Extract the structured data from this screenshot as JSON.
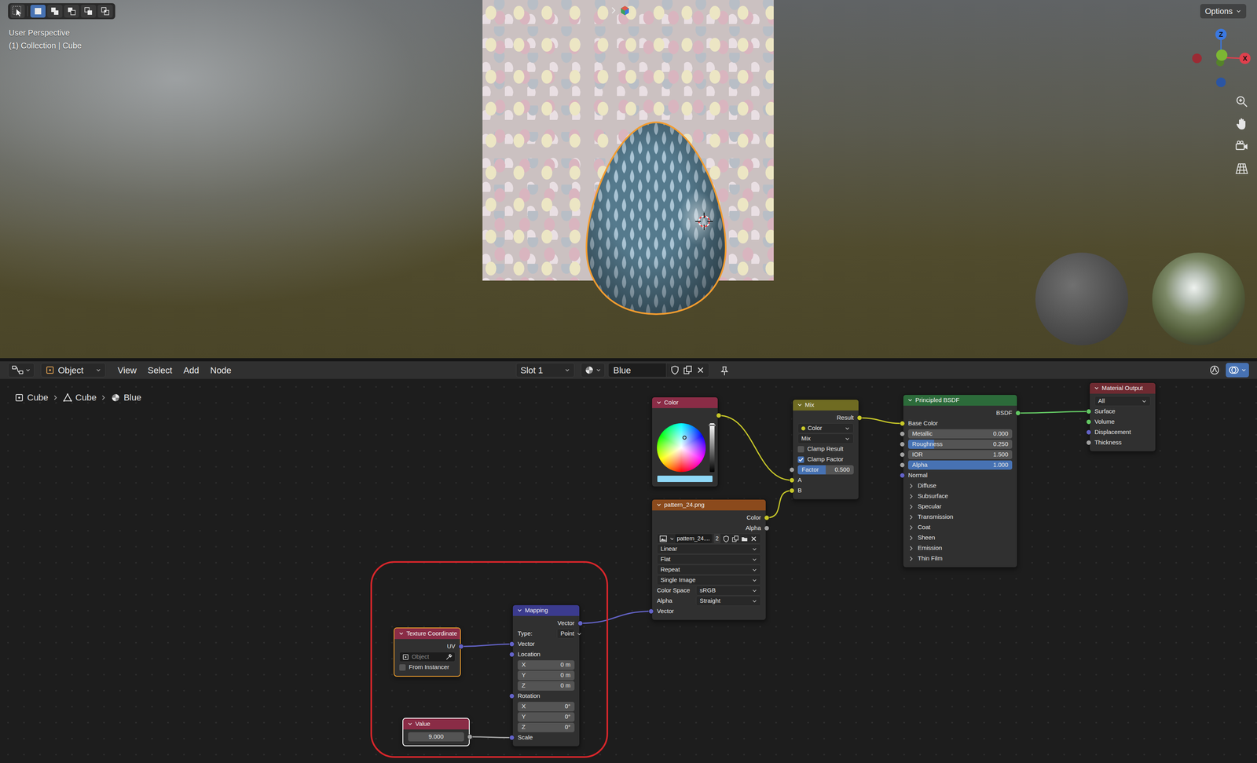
{
  "viewport": {
    "perspective": "User Perspective",
    "context": "(1) Collection | Cube",
    "options": "Options",
    "select_modes": [
      {
        "selected": true
      },
      {
        "selected": false
      },
      {
        "selected": false
      },
      {
        "selected": false
      },
      {
        "selected": false
      }
    ],
    "gizmo": {
      "z": "Z",
      "x": "X"
    }
  },
  "node_editor": {
    "header": {
      "mode": "Object",
      "menus": [
        "View",
        "Select",
        "Add",
        "Node"
      ],
      "slot": "Slot 1",
      "material": "Blue",
      "overlays": true
    },
    "breadcrumb": [
      "Cube",
      "Cube",
      "Blue"
    ],
    "nodes": [
      {
        "title": "Color",
        "color": "#8a2c46",
        "selected": false,
        "active": false,
        "rows": [
          {
            "kind": "output",
            "label": "",
            "socket": "color"
          },
          {
            "kind": "colorwheel",
            "color": "#8fd8f7"
          }
        ]
      },
      {
        "title": "Mix",
        "color": "#6f6b22",
        "selected": false,
        "active": false,
        "rows": [
          {
            "kind": "output",
            "label": "Result",
            "socket": "color"
          },
          {
            "kind": "type-dropdown",
            "value": "Color"
          },
          {
            "kind": "dropdown",
            "value": "Mix"
          },
          {
            "kind": "checkbox",
            "label": "Clamp Result",
            "checked": false
          },
          {
            "kind": "checkbox",
            "label": "Clamp Factor",
            "checked": true
          },
          {
            "kind": "slider",
            "label": "Factor",
            "value": "0.500",
            "level": 0.5,
            "socket": "float"
          },
          {
            "kind": "input",
            "label": "A",
            "socket": "color"
          },
          {
            "kind": "input",
            "label": "B",
            "socket": "color"
          }
        ]
      },
      {
        "title": "Principled BSDF",
        "color": "#2c6b3a",
        "selected": false,
        "active": false,
        "rows": [
          {
            "kind": "output",
            "label": "BSDF",
            "socket": "shader"
          },
          {
            "kind": "input",
            "label": "Base Color",
            "socket": "color"
          },
          {
            "kind": "slider",
            "label": "Metallic",
            "value": "0.000",
            "level": 0,
            "socket": "float"
          },
          {
            "kind": "slider",
            "label": "Roughness",
            "value": "0.250",
            "level": 0.25,
            "socket": "float"
          },
          {
            "kind": "number",
            "label": "IOR",
            "value": "1.500",
            "socket": "float"
          },
          {
            "kind": "slider",
            "label": "Alpha",
            "value": "1.000",
            "level": 1,
            "socket": "float"
          },
          {
            "kind": "input",
            "label": "Normal",
            "socket": "vector"
          },
          {
            "kind": "panel",
            "label": "Diffuse"
          },
          {
            "kind": "panel",
            "label": "Subsurface"
          },
          {
            "kind": "panel",
            "label": "Specular"
          },
          {
            "kind": "panel",
            "label": "Transmission"
          },
          {
            "kind": "panel",
            "label": "Coat"
          },
          {
            "kind": "panel",
            "label": "Sheen"
          },
          {
            "kind": "panel",
            "label": "Emission"
          },
          {
            "kind": "panel",
            "label": "Thin Film"
          }
        ]
      },
      {
        "title": "Material Output",
        "color": "#6e2a31",
        "selected": false,
        "active": false,
        "rows": [
          {
            "kind": "dropdown",
            "value": "All"
          },
          {
            "kind": "input",
            "label": "Surface",
            "socket": "shader"
          },
          {
            "kind": "input",
            "label": "Volume",
            "socket": "shader"
          },
          {
            "kind": "input",
            "label": "Displacement",
            "socket": "vector"
          },
          {
            "kind": "input",
            "label": "Thickness",
            "socket": "float"
          }
        ]
      },
      {
        "title": "pattern_24.png",
        "color": "#8b4a1c",
        "selected": false,
        "active": false,
        "rows": [
          {
            "kind": "output",
            "label": "Color",
            "socket": "color"
          },
          {
            "kind": "output",
            "label": "Alpha",
            "socket": "float"
          },
          {
            "kind": "image",
            "value": "pattern_24....",
            "users": "2"
          },
          {
            "kind": "dropdown",
            "value": "Linear"
          },
          {
            "kind": "dropdown",
            "value": "Flat"
          },
          {
            "kind": "dropdown",
            "value": "Repeat"
          },
          {
            "kind": "dropdown",
            "value": "Single Image"
          },
          {
            "kind": "labeled-dropdown",
            "label": "Color Space",
            "value": "sRGB"
          },
          {
            "kind": "labeled-dropdown",
            "label": "Alpha",
            "value": "Straight"
          },
          {
            "kind": "input",
            "label": "Vector",
            "socket": "vector"
          }
        ]
      },
      {
        "title": "Texture Coordinate",
        "color": "#8a2c46",
        "selected": true,
        "active": false,
        "rows": [
          {
            "kind": "output",
            "label": "UV",
            "socket": "vector"
          },
          {
            "kind": "object-field",
            "placeholder": "Object"
          },
          {
            "kind": "checkbox",
            "label": "From Instancer",
            "checked": false
          }
        ]
      },
      {
        "title": "Mapping",
        "color": "#3b3b8e",
        "selected": false,
        "active": false,
        "rows": [
          {
            "kind": "output",
            "label": "Vector",
            "socket": "vector"
          },
          {
            "kind": "labeled-dropdown",
            "label": "Type:",
            "value": "Point"
          },
          {
            "kind": "input",
            "label": "Vector",
            "socket": "vector"
          },
          {
            "kind": "input",
            "label": "Location",
            "socket": "vector"
          },
          {
            "kind": "vector-field",
            "label": "X",
            "value": "0 m"
          },
          {
            "kind": "vector-field",
            "label": "Y",
            "value": "0 m"
          },
          {
            "kind": "vector-field",
            "label": "Z",
            "value": "0 m"
          },
          {
            "kind": "input",
            "label": "Rotation",
            "socket": "vector"
          },
          {
            "kind": "vector-field",
            "label": "X",
            "value": "0°"
          },
          {
            "kind": "vector-field",
            "label": "Y",
            "value": "0°"
          },
          {
            "kind": "vector-field",
            "label": "Z",
            "value": "0°"
          },
          {
            "kind": "input",
            "label": "Scale",
            "socket": "vector"
          }
        ]
      },
      {
        "title": "Value",
        "color": "#8a2c46",
        "selected": false,
        "active": true,
        "rows": [
          {
            "kind": "value-field",
            "value": "9.000",
            "socket": "float"
          }
        ]
      }
    ]
  }
}
